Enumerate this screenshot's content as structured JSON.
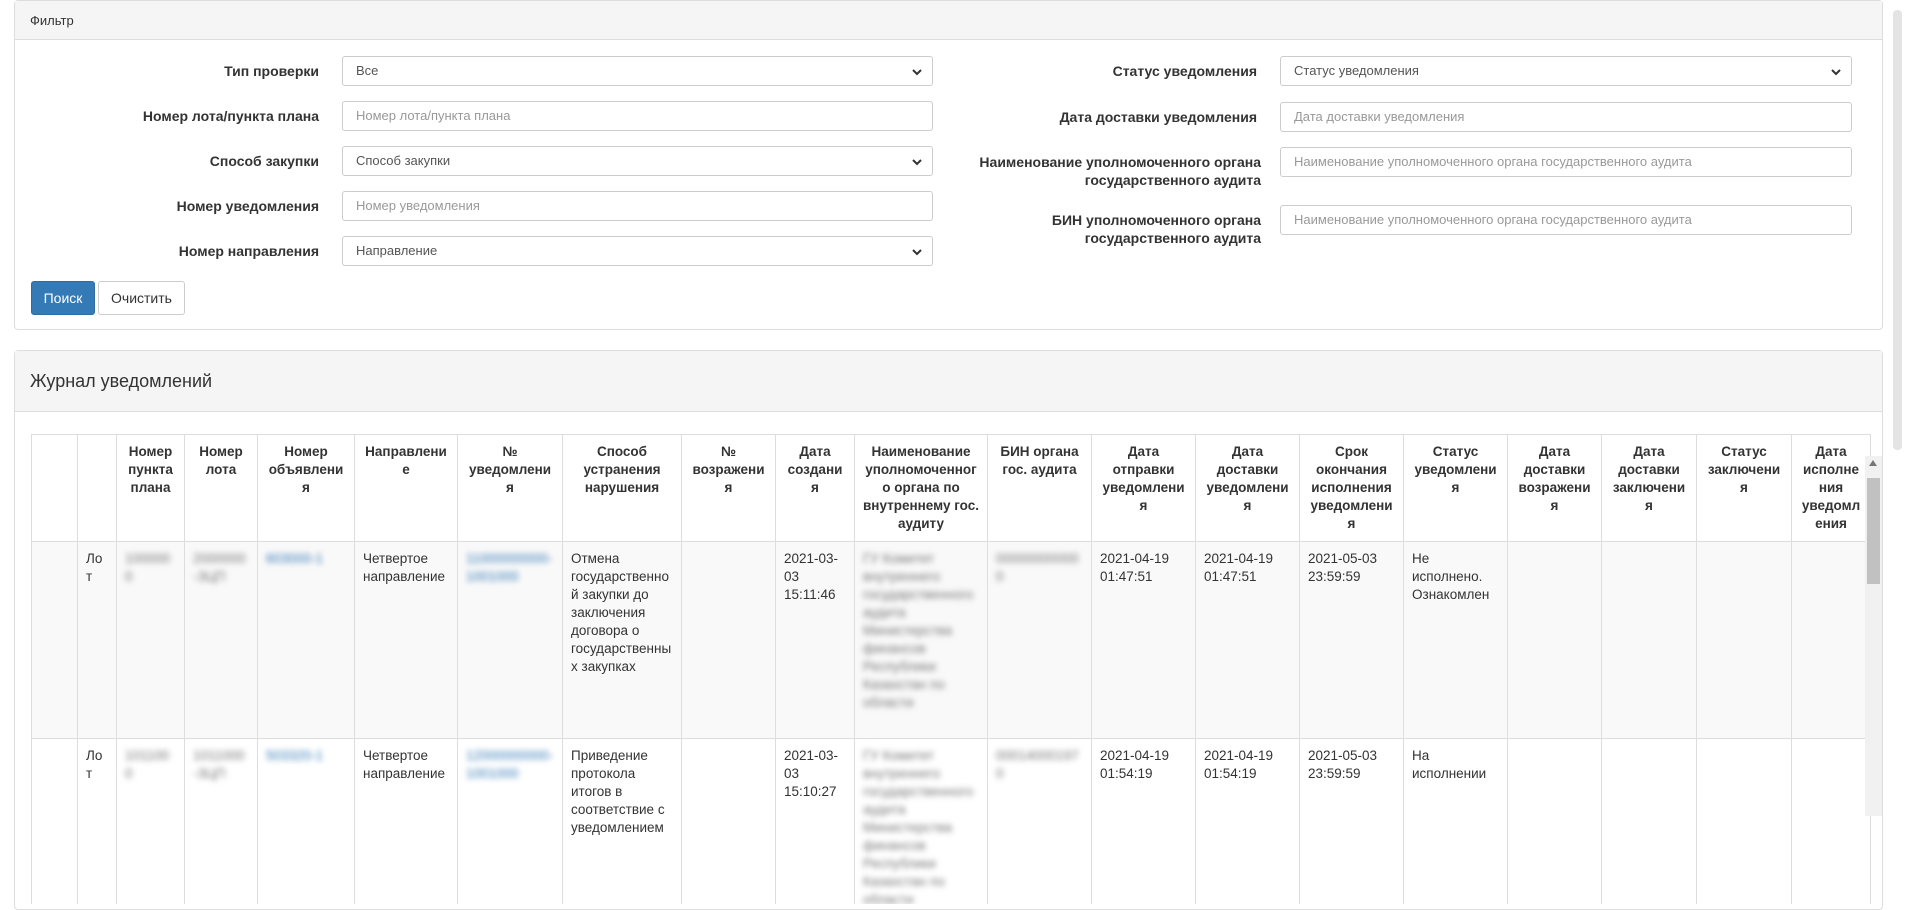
{
  "filter": {
    "title": "Фильтр",
    "left": [
      {
        "label": "Тип проверки",
        "value": "Все",
        "placeholder": "",
        "type": "select"
      },
      {
        "label": "Номер лота/пункта плана",
        "value": "",
        "placeholder": "Номер лота/пункта плана",
        "type": "input"
      },
      {
        "label": "Способ закупки",
        "value": "Способ закупки",
        "placeholder": "",
        "type": "select"
      },
      {
        "label": "Номер уведомления",
        "value": "",
        "placeholder": "Номер уведомления",
        "type": "input"
      },
      {
        "label": "Номер направления",
        "value": "Направление",
        "placeholder": "",
        "type": "select"
      }
    ],
    "right": [
      {
        "label": "Статус уведомления",
        "value": "Статус уведомления",
        "placeholder": "",
        "type": "select"
      },
      {
        "label": "Дата доставки уведомления",
        "value": "",
        "placeholder": "Дата доставки уведомления",
        "type": "input"
      },
      {
        "label": "Наименование уполномоченного органа государственного аудита",
        "value": "",
        "placeholder": "Наименование уполномоченного органа государственного аудита",
        "type": "input"
      },
      {
        "label": "БИН уполномоченного органа государственного аудита",
        "value": "",
        "placeholder": "Наименование уполномоченного органа государственного аудита",
        "type": "input"
      }
    ],
    "search_label": "Поиск",
    "clear_label": "Очистить"
  },
  "journal": {
    "title": "Журнал уведомлений",
    "columns": [
      "",
      "",
      "Номер пункта плана",
      "Номер лота",
      "Номер объявления",
      "Направление",
      "№ уведомления",
      "Способ устранения нарушения",
      "№ возражения",
      "Дата создания",
      "Наименование уполномоченного органа по внутреннему гос. аудиту",
      "БИН органа гос. аудита",
      "Дата отправки уведомления",
      "Дата доставки уведомления",
      "Срок окончания исполнения уведомления",
      "Статус уведомления",
      "Дата доставки возражения",
      "Дата доставки заключения",
      "Статус заключения",
      "Дата исполнения уведомления"
    ],
    "rows": [
      {
        "type": "Лот",
        "plan_no": "1000000",
        "lot_no": "2000000-ЗЦП",
        "announcement_no": "603000-1",
        "direction": "Четвертое направление",
        "notice_no": "11000000000-1001000",
        "remedy": "Отмена государственной закупки до заключения договора о государственных закупках",
        "objection_no": "",
        "created": "2021-03-03 15:11:46",
        "authority": "ГУ Комитет внутреннего государственного аудита Министерства финансов Республики Казахстан по области",
        "bin": "000000000000",
        "sent": "2021-04-19 01:47:51",
        "delivered": "2021-04-19 01:47:51",
        "deadline": "2021-05-03 23:59:59",
        "status": "Не исполнено. Ознакомлен"
      },
      {
        "type": "Лот",
        "plan_no": "1011000",
        "lot_no": "1011000-ЗЦП",
        "announcement_no": "503320-1",
        "direction": "Четвертое направление",
        "notice_no": "12000000000-1001000",
        "remedy": "Приведение протокола итогов в соответствие с уведомлением",
        "objection_no": "",
        "created": "2021-03-03 15:10:27",
        "authority": "ГУ Комитет внутреннего государственного аудита Министерства финансов Республики Казахстан по области",
        "bin": "000140001970",
        "sent": "2021-04-19 01:54:19",
        "delivered": "2021-04-19 01:54:19",
        "deadline": "2021-05-03 23:59:59",
        "status": "На исполнении"
      }
    ]
  }
}
